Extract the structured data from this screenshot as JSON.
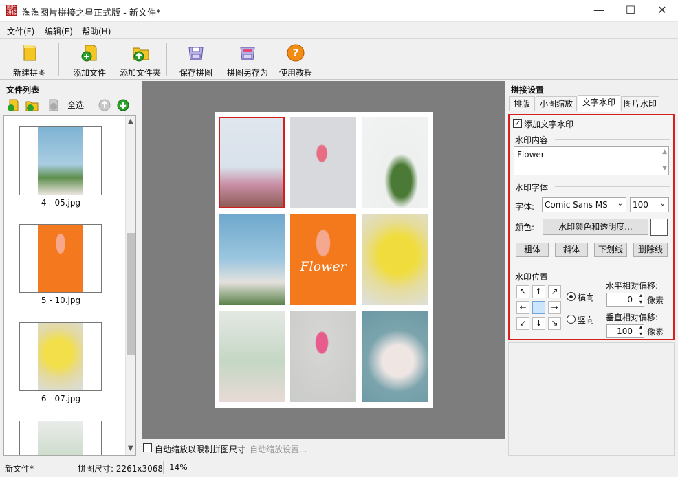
{
  "window": {
    "title": "淘淘图片拼接之星正式版 - 新文件*",
    "minimize": "—",
    "maximize": "☐",
    "close": "✕"
  },
  "menu": [
    "文件(F)",
    "编辑(E)",
    "帮助(H)"
  ],
  "toolbar": [
    {
      "label": "新建拼图",
      "icon": "new-puzzle-icon"
    },
    {
      "label": "添加文件",
      "icon": "add-file-icon"
    },
    {
      "label": "添加文件夹",
      "icon": "add-folder-icon"
    },
    {
      "label": "保存拼图",
      "icon": "save-icon"
    },
    {
      "label": "拼图另存为",
      "icon": "save-as-icon"
    },
    {
      "label": "使用教程",
      "icon": "help-icon",
      "glyph": "?"
    }
  ],
  "file_list": {
    "header": "文件列表",
    "select_all": "全选",
    "files": [
      "4 - 05.jpg",
      "5 - 10.jpg",
      "6 - 07.jpg"
    ]
  },
  "canvas": {
    "watermark_text": "Flower",
    "auto_scale_label": "自动缩放以限制拼图尺寸",
    "auto_scale_settings": "自动缩放设置..."
  },
  "settings": {
    "header": "拼接设置",
    "tabs": [
      "排版",
      "小图缩放",
      "文字水印",
      "图片水印"
    ],
    "enable_text_watermark": "添加文字水印",
    "content_group": "水印内容",
    "content_value": "Flower",
    "font_group": "水印字体",
    "font_label": "字体:",
    "font_name": "Comic Sans MS",
    "font_size": "100",
    "color_label": "颜色:",
    "color_button": "水印颜色和透明度...",
    "style_buttons": [
      "粗体",
      "斜体",
      "下划线",
      "删除线"
    ],
    "position_group": "水印位置",
    "horizontal": "横向",
    "vertical": "竖向",
    "h_offset_label": "水平相对偏移:",
    "h_offset": "0",
    "v_offset_label": "垂直相对偏移:",
    "v_offset": "100",
    "unit": "像素"
  },
  "status": {
    "file": "新文件*",
    "size": "拼图尺寸: 2261x3068",
    "zoom": "14%"
  },
  "colors": {
    "selected_border": "#d31e1e",
    "panel_highlight": "#d72121",
    "canvas_bg": "#7d7d7d"
  }
}
